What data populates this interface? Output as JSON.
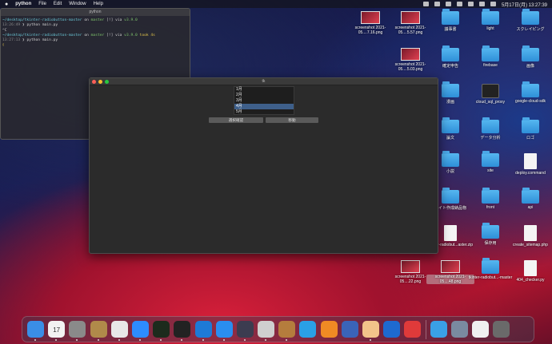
{
  "menubar": {
    "app_name": "python",
    "menus": [
      "File",
      "Edit",
      "Window",
      "Help"
    ],
    "datetime": "5月17日(月) 13:27:39"
  },
  "terminal": {
    "title": "python",
    "lines": [
      {
        "path": "~/desktop/tkinter-radiobutton-master",
        "text": " on ",
        "branch": "master",
        "flags": " [!] via ",
        "ver": "v3.9.0"
      },
      {
        "time": "13:26:49",
        "cmd": "python main.py"
      },
      {
        "plain": "^C"
      },
      {
        "path": "~/desktop/tkinter-radiobutton-master",
        "text": " on ",
        "branch": "master",
        "flags": " [!] via ",
        "ver": "v3.9.0",
        "took": " took 4s"
      },
      {
        "time": "13:27:13",
        "cmd": "python main.py"
      },
      {
        "plain": "▯"
      }
    ]
  },
  "tk_window": {
    "title": "tk",
    "list_items": [
      "1月",
      "2月",
      "3月",
      "4月",
      "5月"
    ],
    "selected_index": 3,
    "button_confirm": "選択確認",
    "button_move": "移動"
  },
  "desktop_icons": [
    {
      "label": "screenshot 2021-05....7.16.png",
      "kind": "shot"
    },
    {
      "label": "screenshot 2021-05....5.57.png",
      "kind": "shot"
    },
    {
      "label": "議事書",
      "kind": "folder"
    },
    {
      "label": "light",
      "kind": "folder"
    },
    {
      "label": "スクレイピング",
      "kind": "folder"
    },
    {
      "label": "screenshot 2021-05....5.03.png",
      "kind": "shot"
    },
    {
      "label": "確定申告",
      "kind": "folder"
    },
    {
      "label": "firebase",
      "kind": "folder"
    },
    {
      "label": "画像",
      "kind": "folder"
    },
    {
      "label": "漫画",
      "kind": "folder"
    },
    {
      "label": "cloud_sql_proxy",
      "kind": "term"
    },
    {
      "label": "google-cloud-sdk",
      "kind": "folder"
    },
    {
      "label": "論文",
      "kind": "folder"
    },
    {
      "label": "データ分析",
      "kind": "folder"
    },
    {
      "label": "ロゴ",
      "kind": "folder"
    },
    {
      "label": "小説",
      "kind": "folder"
    },
    {
      "label": "site",
      "kind": "folder"
    },
    {
      "label": "deploy.command",
      "kind": "doc"
    },
    {
      "label": "サイト作成納品物",
      "kind": "folder"
    },
    {
      "label": "front",
      "kind": "folder"
    },
    {
      "label": "api",
      "kind": "folder"
    },
    {
      "label": "tkinter-radiobut...aster.zip",
      "kind": "doc"
    },
    {
      "label": "保存用",
      "kind": "folder"
    },
    {
      "label": "create_sitemap.php",
      "kind": "doc"
    },
    {
      "label": "screenshot 2021-05....22.png",
      "kind": "shot"
    },
    {
      "label": "screenshot 2021-05....48.png",
      "kind": "shot"
    },
    {
      "label": "tkinter-radiobut...-master",
      "kind": "folder"
    },
    {
      "label": "404_checker.py",
      "kind": "doc"
    }
  ],
  "dock": {
    "apps": [
      {
        "icon": "finder-icon",
        "color": "#3a8ee6"
      },
      {
        "icon": "calendar-icon",
        "color": "#f2f2f2",
        "text": "17"
      },
      {
        "icon": "system-preferences-icon",
        "color": "#8a8a8a"
      },
      {
        "icon": "archive-icon",
        "color": "#b08a4a"
      },
      {
        "icon": "chrome-icon",
        "color": "#e8e8e8"
      },
      {
        "icon": "zoom-icon",
        "color": "#2d8cff"
      },
      {
        "icon": "terminal-green-icon",
        "color": "#1d2b1d"
      },
      {
        "icon": "terminal-icon",
        "color": "#222222"
      },
      {
        "icon": "vscode-icon",
        "color": "#1e7ad6"
      },
      {
        "icon": "safari-icon",
        "color": "#2a8ef0"
      },
      {
        "icon": "quicktime-icon",
        "color": "#3c3c50"
      },
      {
        "icon": "sequel-icon",
        "color": "#cfcfcf"
      },
      {
        "icon": "parcel-icon",
        "color": "#b57d3d"
      },
      {
        "icon": "docker-icon",
        "color": "#2aa0e6"
      },
      {
        "icon": "sourcetree-icon",
        "color": "#f08a24"
      },
      {
        "icon": "toolbox-icon",
        "color": "#3a64b8"
      },
      {
        "icon": "preview-icon",
        "color": "#f2c48a"
      },
      {
        "icon": "remote-icon",
        "color": "#1e6ad0"
      },
      {
        "icon": "clock-icon",
        "color": "#e03a3a"
      },
      {
        "icon": "appstore-icon",
        "color": "#3aa0e6"
      },
      {
        "icon": "photos-folder-icon",
        "color": "#7a8aa0"
      },
      {
        "icon": "document-icon",
        "color": "#f0f0f0"
      },
      {
        "icon": "trash-icon",
        "color": "#6a6a6a"
      }
    ]
  }
}
